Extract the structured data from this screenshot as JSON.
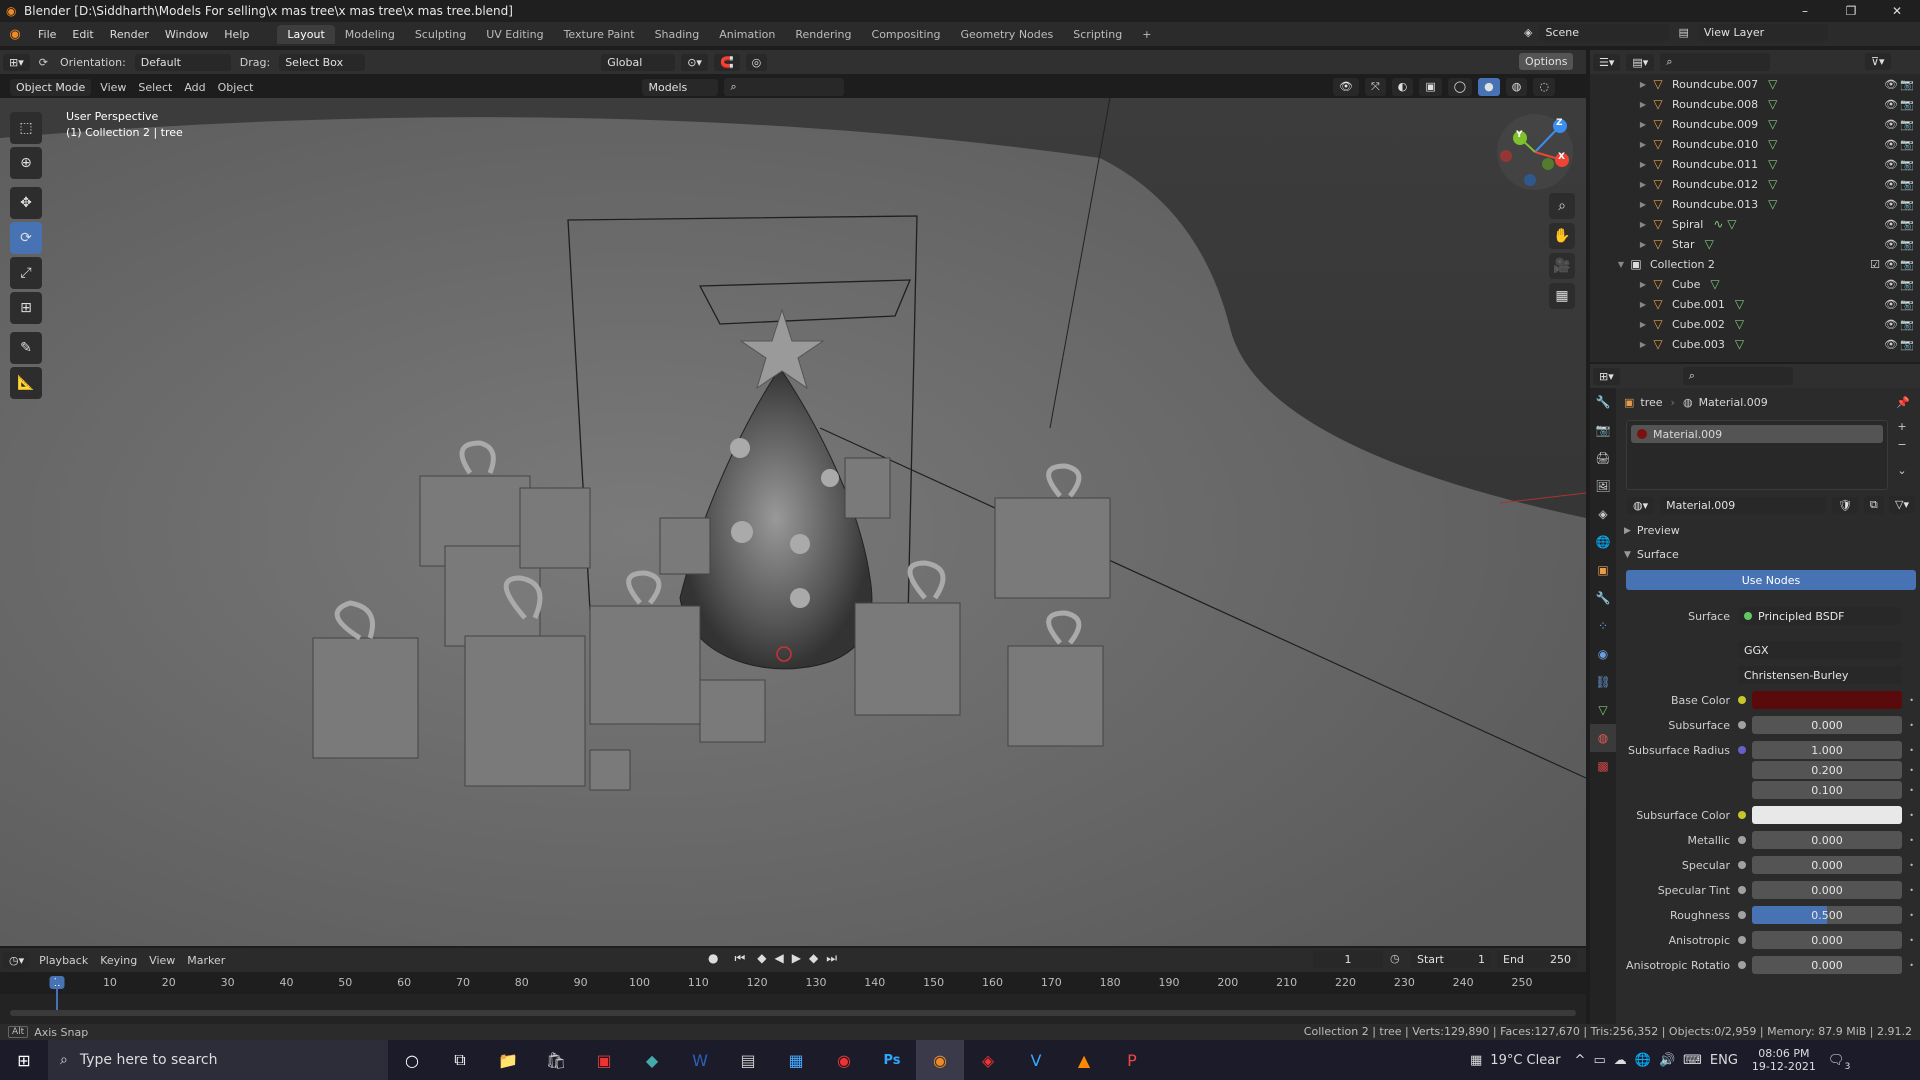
{
  "window": {
    "title": "Blender [D:\\Siddharth\\Models For selling\\x mas tree\\x mas tree\\x mas tree.blend]",
    "minimize": "–",
    "maximize": "❐",
    "close": "✕"
  },
  "menu": [
    "File",
    "Edit",
    "Render",
    "Window",
    "Help"
  ],
  "workspaces": [
    "Layout",
    "Modeling",
    "Sculpting",
    "UV Editing",
    "Texture Paint",
    "Shading",
    "Animation",
    "Rendering",
    "Compositing",
    "Geometry Nodes",
    "Scripting"
  ],
  "active_workspace": "Layout",
  "scene": {
    "name": "Scene",
    "view_layer": "View Layer"
  },
  "header": {
    "orientation_label": "Orientation:",
    "orientation_value": "Default",
    "drag_label": "Drag:",
    "drag_value": "Select Box",
    "transform_space": "Global",
    "options": "Options"
  },
  "viewport_header": {
    "mode": "Object Mode",
    "view": "View",
    "select": "Select",
    "add": "Add",
    "object": "Object",
    "collection_filter": "Models"
  },
  "viewport": {
    "perspective": "User Perspective",
    "context": "(1) Collection 2 | tree",
    "gizmo_labels": {
      "x": "X",
      "y": "Y",
      "z": "Z"
    }
  },
  "outliner": {
    "rows": [
      {
        "name": "Roundcube.007",
        "type": "object",
        "indent": 1,
        "icon": "mesh-data-icon"
      },
      {
        "name": "Roundcube.008",
        "type": "object",
        "indent": 1,
        "icon": "mesh-data-icon"
      },
      {
        "name": "Roundcube.009",
        "type": "object",
        "indent": 1,
        "icon": "mesh-data-icon"
      },
      {
        "name": "Roundcube.010",
        "type": "object",
        "indent": 1,
        "icon": "mesh-data-icon"
      },
      {
        "name": "Roundcube.011",
        "type": "object",
        "indent": 1,
        "icon": "mesh-data-icon"
      },
      {
        "name": "Roundcube.012",
        "type": "object",
        "indent": 1,
        "icon": "mesh-data-icon"
      },
      {
        "name": "Roundcube.013",
        "type": "object",
        "indent": 1,
        "icon": "mesh-data-icon"
      },
      {
        "name": "Spiral",
        "type": "object",
        "indent": 1,
        "icon": "curve-data-icon"
      },
      {
        "name": "Star",
        "type": "object",
        "indent": 1,
        "icon": "mesh-data-icon"
      },
      {
        "name": "Collection 2",
        "type": "collection",
        "indent": 0,
        "icon": "collection-icon"
      },
      {
        "name": "Cube",
        "type": "object",
        "indent": 1,
        "icon": "mesh-data-icon"
      },
      {
        "name": "Cube.001",
        "type": "object",
        "indent": 1,
        "icon": "mesh-data-icon"
      },
      {
        "name": "Cube.002",
        "type": "object",
        "indent": 1,
        "icon": "mesh-data-icon"
      },
      {
        "name": "Cube.003",
        "type": "object",
        "indent": 1,
        "icon": "mesh-data-icon"
      }
    ]
  },
  "properties": {
    "breadcrumb_object": "tree",
    "breadcrumb_material": "Material.009",
    "material_slot": "Material.009",
    "material_name": "Material.009",
    "preview": "Preview",
    "surface_panel": "Surface",
    "use_nodes": "Use Nodes",
    "surface_label": "Surface",
    "surface_value": "Principled BSDF",
    "distribution": "GGX",
    "subsurface_method": "Christensen-Burley",
    "fields": [
      {
        "label": "Base Color",
        "value": "",
        "kind": "color",
        "color": "#5a0a0a",
        "socket": "#c7c729"
      },
      {
        "label": "Subsurface",
        "value": "0.000",
        "kind": "number",
        "socket": "#a1a1a1"
      },
      {
        "label": "Subsurface Radius",
        "value": "1.000",
        "kind": "number",
        "socket": "#6363c7"
      },
      {
        "label": "",
        "value": "0.200",
        "kind": "number",
        "socket": ""
      },
      {
        "label": "",
        "value": "0.100",
        "kind": "number",
        "socket": ""
      },
      {
        "label": "Subsurface Color",
        "value": "",
        "kind": "color",
        "color": "#e8e8e8",
        "socket": "#c7c729"
      },
      {
        "label": "Metallic",
        "value": "0.000",
        "kind": "number",
        "socket": "#a1a1a1"
      },
      {
        "label": "Specular",
        "value": "0.000",
        "kind": "number",
        "socket": "#a1a1a1"
      },
      {
        "label": "Specular Tint",
        "value": "0.000",
        "kind": "number",
        "socket": "#a1a1a1"
      },
      {
        "label": "Roughness",
        "value": "0.500",
        "kind": "slider",
        "fill": 0.5,
        "socket": "#a1a1a1"
      },
      {
        "label": "Anisotropic",
        "value": "0.000",
        "kind": "number",
        "socket": "#a1a1a1"
      },
      {
        "label": "Anisotropic Rotatio",
        "value": "0.000",
        "kind": "number",
        "socket": "#a1a1a1"
      }
    ]
  },
  "timeline": {
    "playback": "Playback",
    "keying": "Keying",
    "view": "View",
    "marker": "Marker",
    "current_frame": "1",
    "start_label": "Start",
    "start": "1",
    "end_label": "End",
    "end": "250",
    "ruler": [
      "1",
      "10",
      "20",
      "30",
      "40",
      "50",
      "60",
      "70",
      "80",
      "90",
      "100",
      "110",
      "120",
      "130",
      "140",
      "150",
      "160",
      "170",
      "180",
      "190",
      "200",
      "210",
      "220",
      "230",
      "240",
      "250"
    ]
  },
  "statusbar": {
    "key": "Alt",
    "hint": "Axis Snap",
    "stats": "Collection 2 | tree | Verts:129,890 | Faces:127,670 | Tris:256,352 | Objects:0/2,959 | Memory: 87.9 MiB | 2.91.2"
  },
  "taskbar": {
    "search_placeholder": "Type here to search",
    "weather": "19°C Clear",
    "lang": "ENG",
    "time": "08:06 PM",
    "date": "19-12-2021",
    "notifications": "3"
  },
  "colors": {
    "accent": "#4772b3",
    "object_icon": "#e59c4b",
    "mesh_icon": "#7ec97e"
  }
}
